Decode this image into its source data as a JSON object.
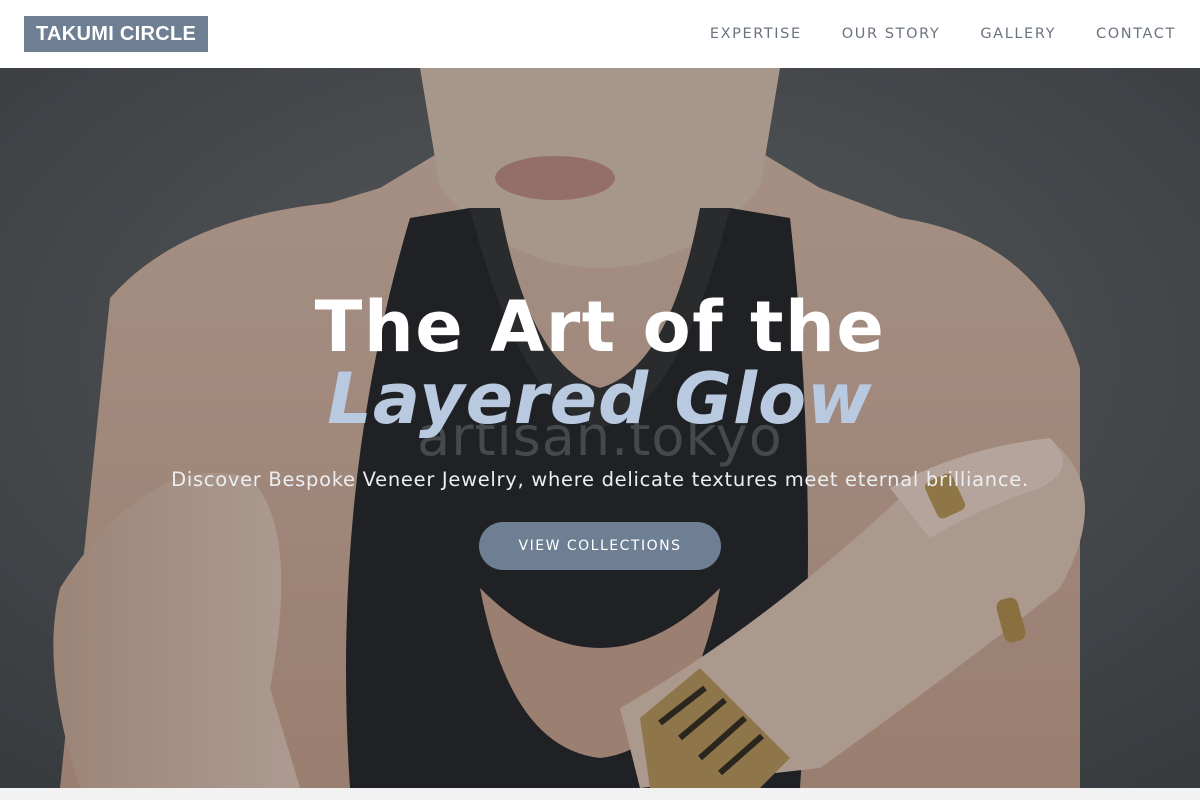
{
  "brand": {
    "name": "TAKUMI CIRCLE",
    "color": "#6e7f94"
  },
  "nav": {
    "items": [
      {
        "label": "EXPERTISE"
      },
      {
        "label": "OUR STORY"
      },
      {
        "label": "GALLERY"
      },
      {
        "label": "CONTACT"
      }
    ]
  },
  "hero": {
    "title_line1": "The Art of the",
    "title_line2": "Layered Glow",
    "watermark": "artisan.tokyo",
    "subtitle": "Discover Bespoke Veneer Jewelry, where delicate textures meet eternal brilliance.",
    "cta_label": "VIEW COLLECTIONS",
    "accent_color": "#b9c9e0"
  }
}
